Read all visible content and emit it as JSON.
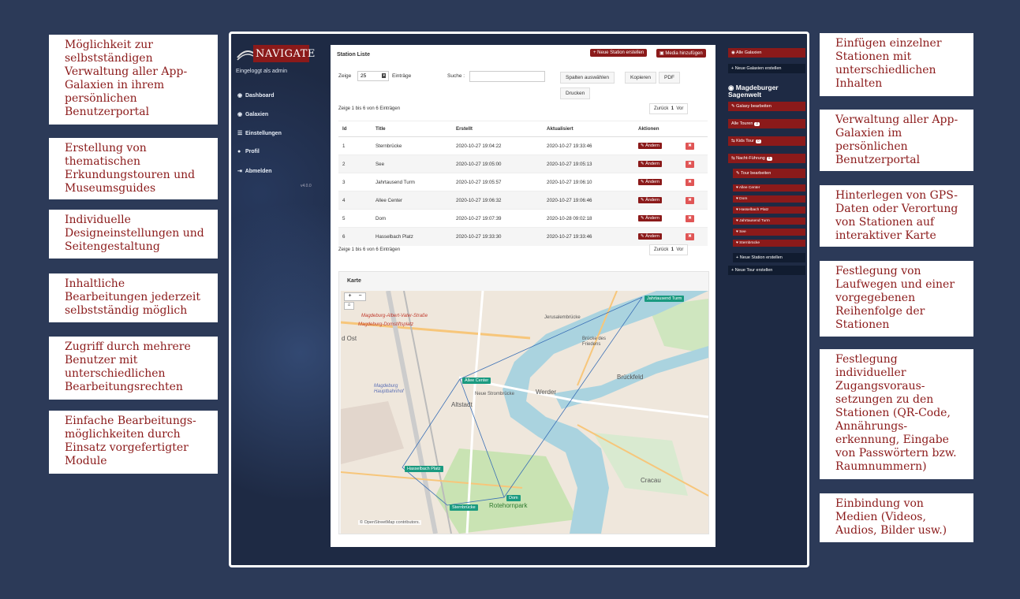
{
  "notes_left": [
    "Möglichkeit zur selbstständigen Verwaltung aller App-Galaxien in ihrem persönlichen Benutzerportal",
    "Erstellung von thematischen Erkundungstouren und Museumsguides",
    "Individuelle Designeinstellungen und Seitengestaltung",
    "Inhaltliche Bearbeitungen jederzeit selbstständig möglich",
    "Zugriff durch mehrere Benutzer mit unterschiedlichen Bearbeitungsrechten",
    "Einfache Bearbeitungs-möglichkeiten durch Einsatz vorgefertigter Module"
  ],
  "notes_right": [
    "Einfügen einzelner Stationen mit unterschiedlichen Inhalten",
    "Verwaltung aller App-Galaxien im persönlichen Benutzerportal",
    "Hinterlegen von GPS-Daten oder Verortung von Stationen auf interaktiver Karte",
    "Festlegung von Laufwegen und einer vorgegebenen Reihenfolge der Stationen",
    "Festlegung individueller Zugangsvoraus-setzungen zu den Stationen (QR-Code, Annährungs-erkennung, Eingabe von Passwörtern bzw. Raumnummern)",
    "Einbindung von Medien (Videos, Audios, Bilder usw.)"
  ],
  "app": {
    "logo": "NAVIGATE",
    "logged_in": "Eingeloggt als admin",
    "nav": [
      {
        "icon": "dashboard-icon",
        "glyph": "◉",
        "label": "Dashboard"
      },
      {
        "icon": "galaxy-icon",
        "glyph": "◉",
        "label": "Galaxien"
      },
      {
        "icon": "settings-icon",
        "glyph": "☰",
        "label": "Einstellungen"
      },
      {
        "icon": "profile-icon",
        "glyph": "●",
        "label": "Profil"
      },
      {
        "icon": "logout-icon",
        "glyph": "⇥",
        "label": "Abmelden"
      }
    ],
    "version": "v4.0.0"
  },
  "panel": {
    "title": "Station Liste",
    "new_station": "+ Neue Station erstellen",
    "add_media": "▣ Media hinzufügen",
    "show_label": "Zeige",
    "show_value": "25",
    "entries_label": "Einträge",
    "search_label": "Suche :",
    "col_select": "Spalten auswählen",
    "copy": "Kopieren",
    "pdf": "PDF",
    "print": "Drucken",
    "info": "Zeige 1 bis 6 von 6 Einträgen",
    "prev": "Zurück",
    "page": "1",
    "next": "Vor",
    "headers": [
      "Id",
      "Title",
      "Erstellt",
      "Aktualisiert",
      "Aktionen"
    ],
    "rows": [
      {
        "id": "1",
        "title": "Sternbrücke",
        "created": "2020-10-27 19:04:22",
        "updated": "2020-10-27 19:33:46"
      },
      {
        "id": "2",
        "title": "See",
        "created": "2020-10-27 19:05:00",
        "updated": "2020-10-27 19:05:13"
      },
      {
        "id": "3",
        "title": "Jahrtausend Turm",
        "created": "2020-10-27 19:05:57",
        "updated": "2020-10-27 19:06:10"
      },
      {
        "id": "4",
        "title": "Allee Center",
        "created": "2020-10-27 19:06:32",
        "updated": "2020-10-27 19:06:46"
      },
      {
        "id": "5",
        "title": "Dom",
        "created": "2020-10-27 19:07:39",
        "updated": "2020-10-28 09:02:18"
      },
      {
        "id": "6",
        "title": "Hasselbach Platz",
        "created": "2020-10-27 19:33:30",
        "updated": "2020-10-27 19:33:46"
      }
    ],
    "edit_label": "✎ Ändern",
    "delete_glyph": "🗑",
    "map_title": "Karte",
    "zoom_in": "+",
    "zoom_out": "−",
    "map_markers": [
      "Jahrtausend Turm",
      "Allee Center",
      "Hasselbach Platz",
      "Dom",
      "Sternbrücke"
    ],
    "map_labels": [
      "Magdeburg-Albert-Vater-Straße",
      "Magdeburg-Domstiftsplatz",
      "Jerusalembrücke",
      "Brücke des Friedens",
      "Magdeburg Hauptbahnhof",
      "Neue Strombrücke",
      "Werder",
      "Altstadt",
      "Brückfeld",
      "Rotehornpark",
      "Cracau",
      "d Ost",
      "© OpenStreetMap contributors."
    ]
  },
  "sidebar": {
    "all_galaxies": "◉ Alle Galaxien",
    "new_galaxy": "+ Neue Galaxien erstellen",
    "galaxy_name": "◉ Magdeburger Sagenwelt",
    "edit_galaxy": "✎ Galaxy bearbeiten",
    "all_tours": "Alle Touren",
    "all_tours_count": "2",
    "kids_tour": "⇆ Kids Tour",
    "kids_tour_count": "0",
    "night_tour": "⇆ Nacht-Führung",
    "night_tour_count": "6",
    "edit_tour": "✎ Tour bearbeiten",
    "stations": [
      "♥ Allee Center",
      "♥ Dom",
      "♥ Hasselbach Platz",
      "♥ Jahrtausend Turm",
      "♥ See",
      "♥ Sternbrücke"
    ],
    "new_station": "+ Neue Station erstellen",
    "new_tour": "+ Neue Tour erstellen"
  },
  "colors": {
    "brand_red": "#8b1a1a",
    "background": "#2c3a58",
    "marker": "#1a9a80"
  }
}
